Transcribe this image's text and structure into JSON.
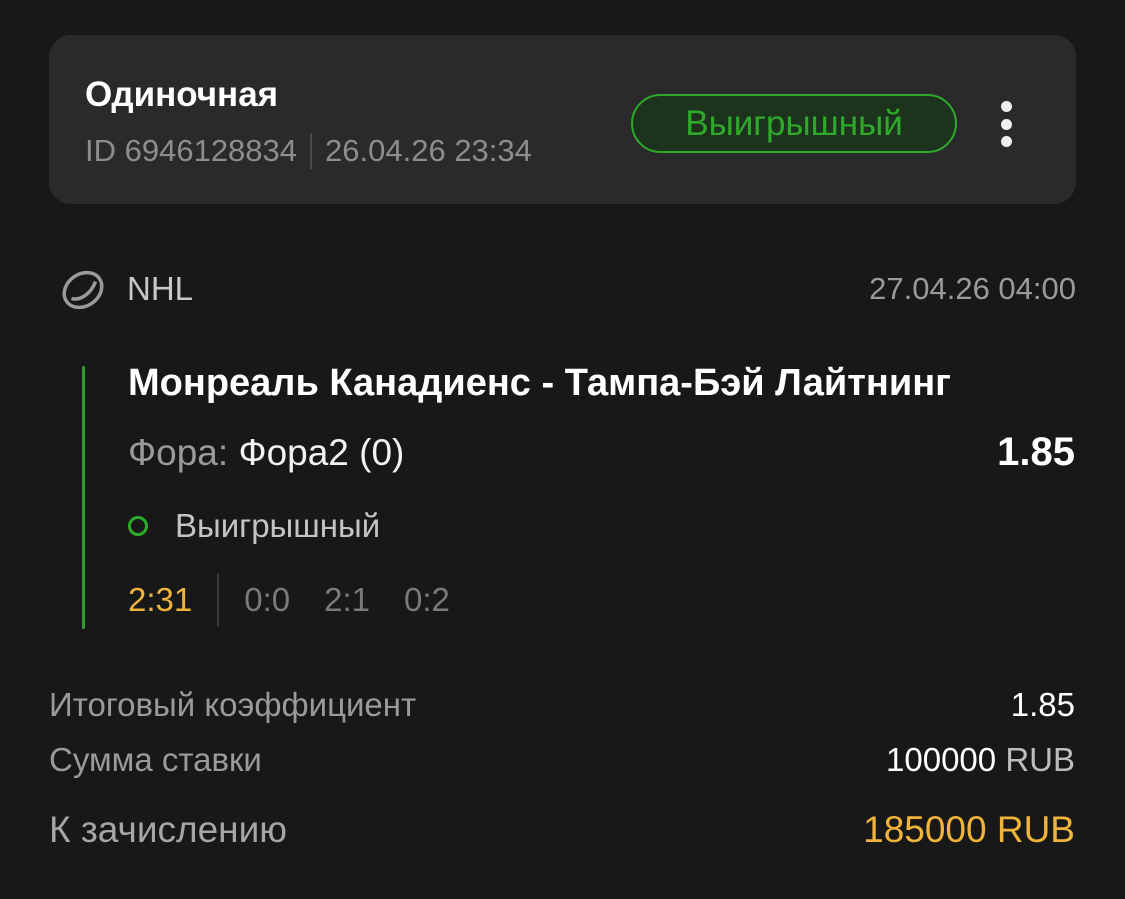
{
  "header": {
    "bet_type": "Одиночная",
    "bet_id": "ID 6946128834",
    "datetime": "26.04.26 23:34",
    "status": "Выигрышный",
    "more_icon": "more-vertical-icon"
  },
  "event": {
    "sport_icon": "hockey-puck-icon",
    "league": "NHL",
    "start_time": "27.04.26 04:00",
    "match": "Монреаль Канадиенс - Тампа-Бэй Лайтнинг",
    "market_name": "Фора:",
    "market_value": "Фора2 (0)",
    "odds": "1.85",
    "result": "Выигрышный",
    "score": "2:31",
    "periods": [
      "0:0",
      "2:1",
      "0:2"
    ]
  },
  "summary": {
    "total_odds_label": "Итоговый коэффициент",
    "total_odds": "1.85",
    "stake_label": "Сумма ставки",
    "stake_amount": "100000",
    "stake_currency": "RUB",
    "payout_label": "К зачислению",
    "payout_amount": "185000 RUB"
  },
  "colors": {
    "accent_green": "#2eaa2a",
    "accent_gold": "#f0b43c",
    "background": "#181818",
    "card": "#2a2a2a"
  }
}
